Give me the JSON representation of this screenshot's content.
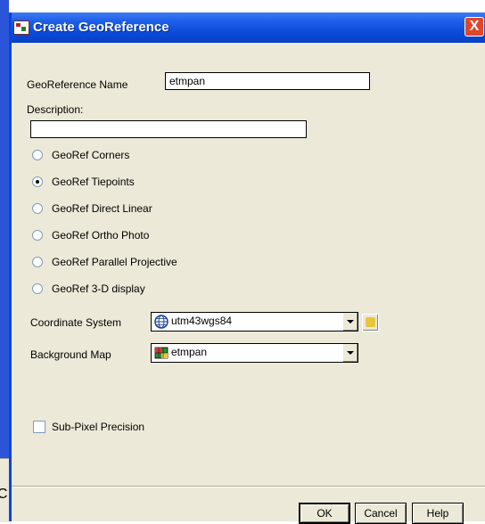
{
  "window": {
    "title": "Create GeoReference",
    "close_label": "X"
  },
  "form": {
    "name_label": "GeoReference Name",
    "name_value": "etmpan",
    "description_label": "Description:",
    "description_value": ""
  },
  "radio_options": [
    {
      "label": "GeoRef Corners",
      "checked": false
    },
    {
      "label": "GeoRef Tiepoints",
      "checked": true
    },
    {
      "label": "GeoRef Direct Linear",
      "checked": false
    },
    {
      "label": "GeoRef Ortho Photo",
      "checked": false
    },
    {
      "label": "GeoRef Parallel Projective",
      "checked": false
    },
    {
      "label": "GeoRef 3-D display",
      "checked": false
    }
  ],
  "coordinate_system": {
    "label": "Coordinate System",
    "value": "utm43wgs84",
    "icon": "globe-icon"
  },
  "background_map": {
    "label": "Background Map",
    "value": "etmpan",
    "icon": "map-icon"
  },
  "sub_pixel": {
    "label": "Sub-Pixel Precision",
    "checked": false
  },
  "buttons": {
    "ok": "OK",
    "cancel": "Cancel",
    "help": "Help"
  },
  "outside_glyph": "C"
}
